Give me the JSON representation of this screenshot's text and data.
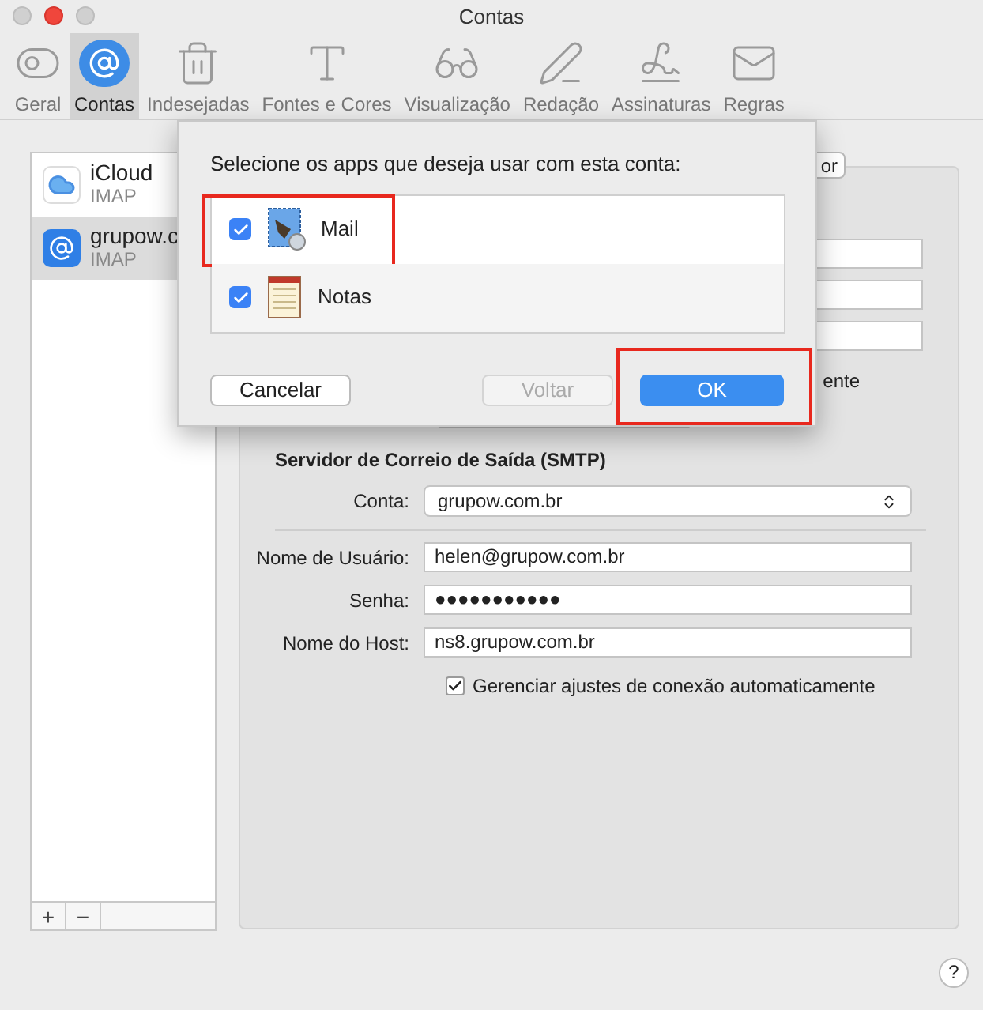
{
  "window": {
    "title": "Contas"
  },
  "toolbar": {
    "items": [
      {
        "label": "Geral",
        "selected": false
      },
      {
        "label": "Contas",
        "selected": true
      },
      {
        "label": "Indesejadas",
        "selected": false
      },
      {
        "label": "Fontes e Cores",
        "selected": false
      },
      {
        "label": "Visualização",
        "selected": false
      },
      {
        "label": "Redação",
        "selected": false
      },
      {
        "label": "Assinaturas",
        "selected": false
      },
      {
        "label": "Regras",
        "selected": false
      }
    ]
  },
  "accounts": [
    {
      "name": "iCloud",
      "type": "IMAP",
      "selected": false
    },
    {
      "name": "grupow.c",
      "type": "IMAP",
      "selected": true
    }
  ],
  "account_actions": [
    "+",
    "−"
  ],
  "account_details": {
    "button_fragment": "or",
    "option_fragment": "ente"
  },
  "smtp": {
    "heading": "Servidor de Correio de Saída (SMTP)",
    "account_label": "Conta:",
    "account_value": "grupow.com.br",
    "fields": [
      {
        "label": "Nome de Usuário:",
        "value": "helen@grupow.com.br"
      },
      {
        "label": "Senha:",
        "value": "●●●●●●●●●●●"
      },
      {
        "label": "Nome do Host:",
        "value": "ns8.grupow.com.br"
      }
    ],
    "auto_settings": {
      "label": "Gerenciar ajustes de conexão automaticamente",
      "checked": true
    }
  },
  "sheet": {
    "prompt": "Selecione os apps que deseja usar com esta conta:",
    "apps": [
      {
        "name": "Mail",
        "checked": true,
        "highlighted": true
      },
      {
        "name": "Notas",
        "checked": true,
        "highlighted": false
      }
    ],
    "buttons": [
      {
        "label": "Cancelar",
        "kind": "normal",
        "highlighted": false
      },
      {
        "label": "Voltar",
        "kind": "disabled",
        "highlighted": false
      },
      {
        "label": "OK",
        "kind": "default",
        "highlighted": true
      }
    ]
  },
  "help": "?"
}
